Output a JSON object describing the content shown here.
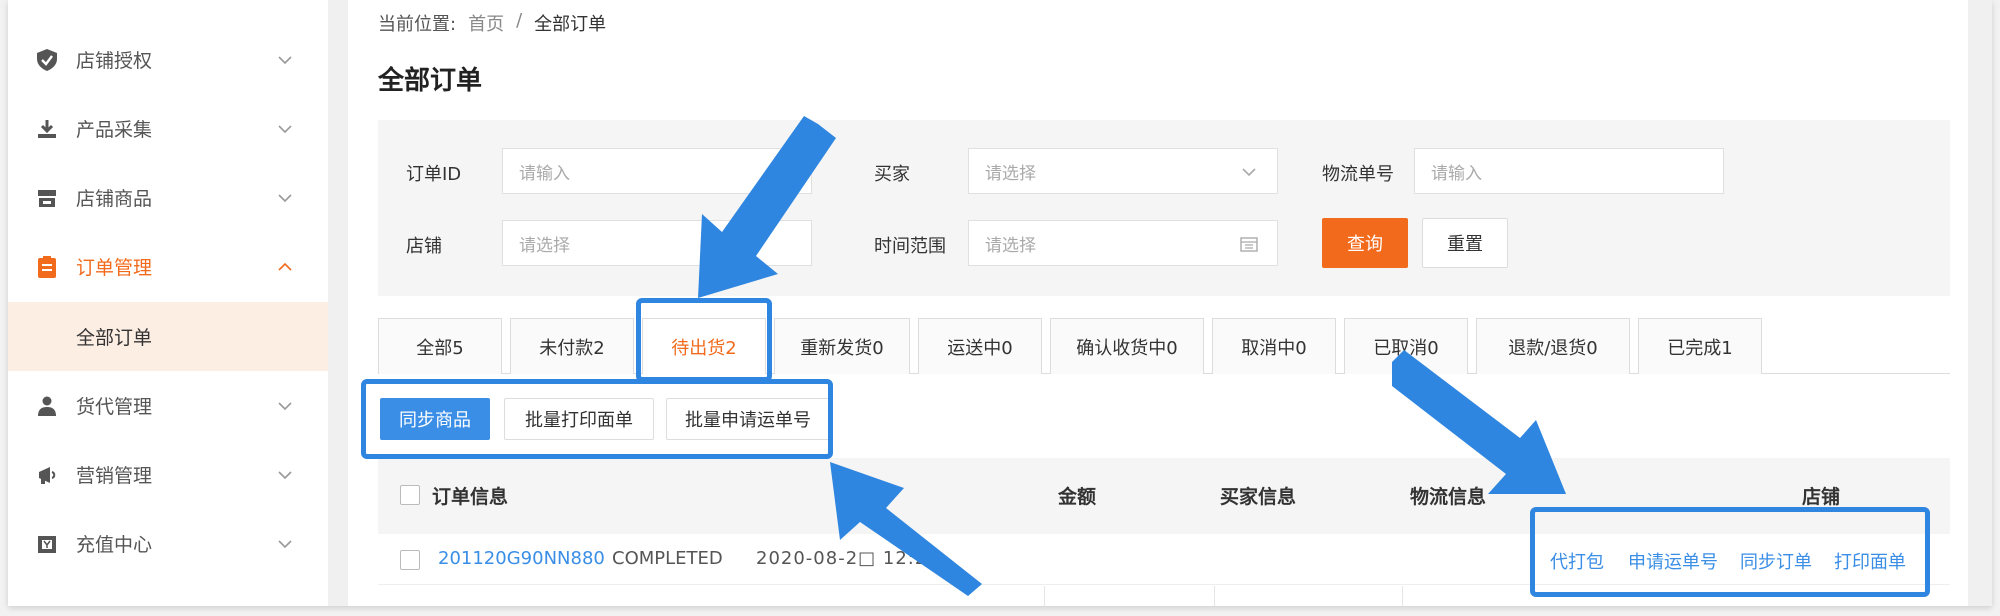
{
  "sidebar": {
    "items": [
      {
        "label": "店铺授权",
        "icon": "shield-check-icon"
      },
      {
        "label": "产品采集",
        "icon": "download-icon"
      },
      {
        "label": "店铺商品",
        "icon": "store-icon"
      },
      {
        "label": "订单管理",
        "icon": "clipboard-icon"
      },
      {
        "label": "货代管理",
        "icon": "person-icon"
      },
      {
        "label": "营销管理",
        "icon": "megaphone-icon"
      },
      {
        "label": "充值中心",
        "icon": "wallet-icon"
      }
    ],
    "sub_item": "全部订单"
  },
  "breadcrumb": {
    "prefix": "当前位置:",
    "home": "首页",
    "sep": "/",
    "current": "全部订单"
  },
  "page_title": "全部订单",
  "filters": {
    "order_id_label": "订单ID",
    "order_id_placeholder": "请输入",
    "buyer_label": "买家",
    "buyer_placeholder": "请选择",
    "tracking_label": "物流单号",
    "tracking_placeholder": "请输入",
    "shop_label": "店铺",
    "shop_placeholder": "请选择",
    "time_label": "时间范围",
    "time_placeholder": "请选择",
    "search_button": "查询",
    "reset_button": "重置"
  },
  "tabs": [
    "全部5",
    "未付款2",
    "待出货2",
    "重新发货0",
    "运送中0",
    "确认收货中0",
    "取消中0",
    "已取消0",
    "退款/退货0",
    "已完成1"
  ],
  "active_tab_index": 2,
  "actions": {
    "sync": "同步商品",
    "batch_print": "批量打印面单",
    "batch_apply": "批量申请运单号"
  },
  "table": {
    "headers": {
      "order": "订单信息",
      "amount": "金额",
      "buyer": "买家信息",
      "logistics": "物流信息",
      "shop": "店铺"
    },
    "rows": [
      {
        "order_id": "201120G90NN880",
        "status": "COMPLETED",
        "time": "2020-08-2□ 12:27",
        "links": [
          "代打包",
          "申请运单号",
          "同步订单",
          "打印面单"
        ]
      }
    ]
  },
  "colors": {
    "accent": "#f26b1d",
    "link": "#3a8ee6",
    "annotation": "#2f86e0"
  }
}
